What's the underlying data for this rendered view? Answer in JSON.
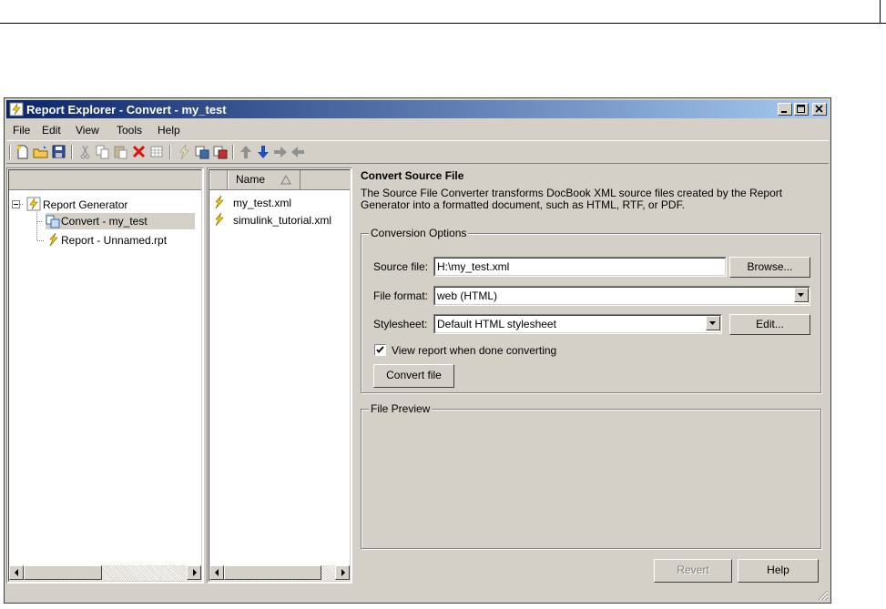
{
  "window": {
    "title": "Report Explorer - Convert - my_test"
  },
  "menu": [
    "File",
    "Edit",
    "View",
    "Tools",
    "Help"
  ],
  "toolbar": [
    "new-icon",
    "open-icon",
    "save-icon",
    "cut-icon",
    "copy-icon",
    "paste-icon",
    "delete-icon",
    "table-icon",
    "lightning-icon",
    "report-icon",
    "report-icon-2",
    "move-up-icon",
    "move-down-icon",
    "move-right-icon",
    "move-left-icon"
  ],
  "tree": {
    "root": "Report Generator",
    "children": [
      "Convert - my_test",
      "Report - Unnamed.rpt"
    ]
  },
  "file_list": {
    "column": "Name",
    "items": [
      "my_test.xml",
      "simulink_tutorial.xml"
    ]
  },
  "convert": {
    "heading": "Convert Source File",
    "description": "The Source File Converter transforms DocBook XML source files created by the Report Generator into a formatted document, such as HTML, RTF, or PDF.",
    "options_label": "Conversion Options",
    "source_label": "Source file:",
    "source_value": "H:\\my_test.xml",
    "browse_label": "Browse...",
    "format_label": "File format:",
    "format_value": "web (HTML)",
    "stylesheet_label": "Stylesheet:",
    "stylesheet_value": "Default HTML stylesheet",
    "edit_label": "Edit...",
    "view_report_label": "View report when done converting",
    "view_report_checked": true,
    "convert_label": "Convert file",
    "preview_label": "File Preview",
    "revert_label": "Revert",
    "help_label": "Help"
  },
  "colors": {
    "title_start": "#0a246a",
    "title_end": "#a6caf0",
    "face": "#d4d0c8",
    "selection": "#d4d0c8"
  }
}
